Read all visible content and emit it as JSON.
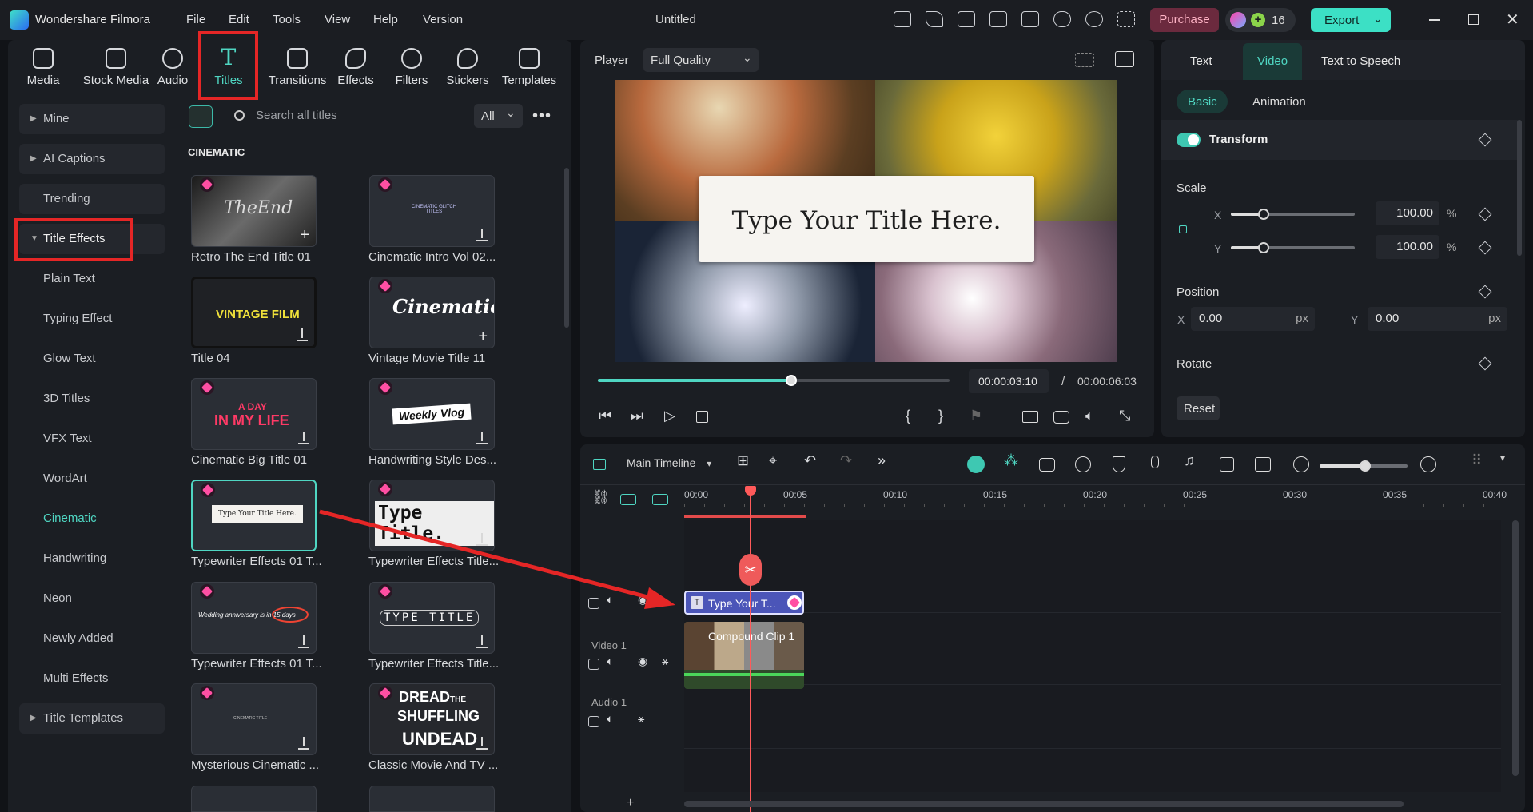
{
  "app": {
    "name": "Wondershare Filmora",
    "doc_title": "Untitled"
  },
  "menu": [
    "File",
    "Edit",
    "Tools",
    "View",
    "Help",
    "Version"
  ],
  "header": {
    "purchase": "Purchase",
    "credits": "16",
    "export": "Export"
  },
  "media_tabs": [
    "Media",
    "Stock Media",
    "Audio",
    "Titles",
    "Transitions",
    "Effects",
    "Filters",
    "Stickers",
    "Templates"
  ],
  "sidebar": {
    "mine": "Mine",
    "ai_captions": "AI Captions",
    "trending": "Trending",
    "title_effects": "Title Effects",
    "sub": [
      "Plain Text",
      "Typing Effect",
      "Glow Text",
      "3D Titles",
      "VFX Text",
      "WordArt",
      "Cinematic",
      "Handwriting",
      "Neon",
      "Newly Added",
      "Multi Effects"
    ],
    "title_templates": "Title Templates"
  },
  "search": {
    "placeholder": "Search all titles",
    "filter": "All"
  },
  "section_title": "CINEMATIC",
  "thumbs": {
    "t1": "Retro The End Title 01",
    "t1_art": "TheEnd",
    "t2": "Cinematic Intro Vol 02...",
    "t2_art": "CINEMATIC GLITCH TITLES",
    "t3": "Title 04",
    "t3_art": "VINTAGE FILM",
    "t4": "Vintage Movie Title 11",
    "t4_art": "Cinematic",
    "t5": "Cinematic Big Title 01",
    "t5_art1": "A DAY",
    "t5_art2": "IN MY LIFE",
    "t6": "Handwriting Style Des...",
    "t6_art": "Weekly Vlog",
    "t7": "Typewriter Effects 01 T...",
    "t7_art": "Type Your Title Here.",
    "t8": "Typewriter Effects Title...",
    "t8_art": "Type Title.",
    "t9": "Typewriter Effects 01 T...",
    "t9_art": "Wedding anniversary is in 15 days",
    "t10": "Typewriter Effects Title...",
    "t10_art": "TYPE TITLE",
    "t11": "Mysterious Cinematic ...",
    "t11_art": "CINEMATIC TITLE",
    "t12": "Classic Movie And TV ...",
    "t12_art1": "DREAD",
    "t12_art2": "THE",
    "t12_art3": "SHUFFLING",
    "t12_art4": "UNDEAD"
  },
  "player": {
    "label": "Player",
    "quality": "Full Quality",
    "overlay_title": "Type Your Title Here.",
    "current": "00:00:03:10",
    "sep": "/",
    "total": "00:00:06:03",
    "progress": 0.55
  },
  "props": {
    "tabs": [
      "Text",
      "Video",
      "Text to Speech"
    ],
    "subtabs": [
      "Basic",
      "Animation"
    ],
    "transform": "Transform",
    "scale": "Scale",
    "x": "X",
    "y": "Y",
    "scale_x": "100.00",
    "scale_y": "100.00",
    "pct": "%",
    "position": "Position",
    "pos_x": "0.00",
    "pos_y": "0.00",
    "px": "px",
    "rotate": "Rotate",
    "reset": "Reset"
  },
  "timeline": {
    "name": "Main Timeline",
    "ruler": [
      "00:00",
      "00:05",
      "00:10",
      "00:15",
      "00:20",
      "00:25",
      "00:30",
      "00:35",
      "00:40"
    ],
    "title_clip": "Type Your T...",
    "compound_clip": "Compound Clip 1",
    "video_track": "Video 1",
    "audio_track": "Audio 1",
    "add": "+"
  },
  "colors": {
    "accent": "#4fd6c2",
    "highlight": "#e52626",
    "playhead": "#ff5a5a"
  }
}
